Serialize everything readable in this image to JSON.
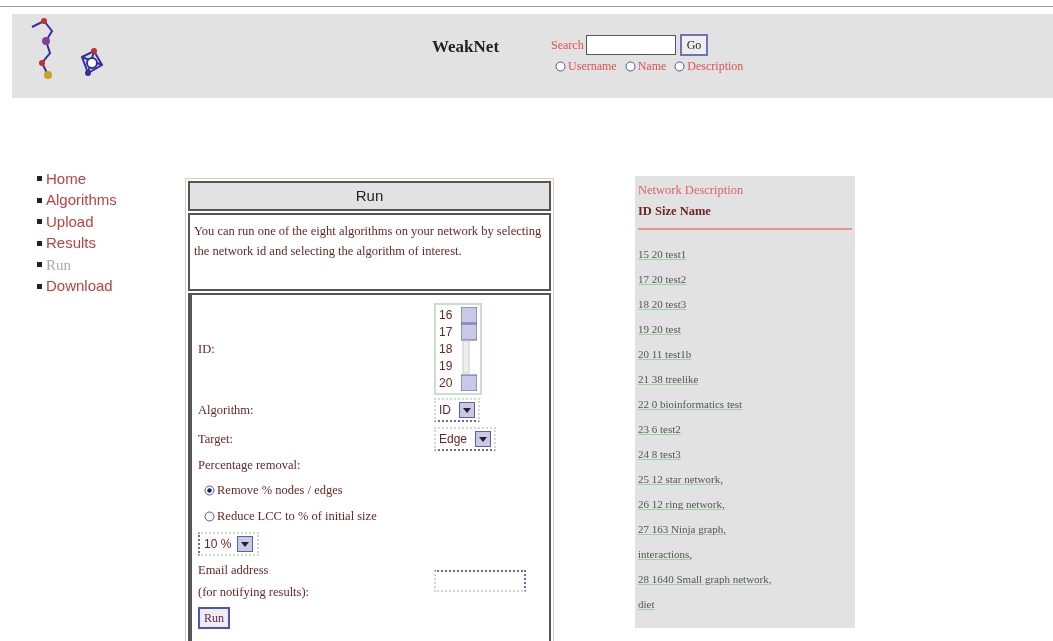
{
  "header": {
    "title": "WeakNet",
    "search": {
      "label": "Search",
      "button": "Go",
      "options": [
        {
          "label": "Username",
          "selected": false
        },
        {
          "label": "Name",
          "selected": false
        },
        {
          "label": "Description",
          "selected": false
        }
      ]
    }
  },
  "nav": [
    {
      "label": "Home",
      "selected": false
    },
    {
      "label": "Algorithms",
      "selected": false
    },
    {
      "label": "Upload",
      "selected": false
    },
    {
      "label": "Results",
      "selected": false
    },
    {
      "label": "Run",
      "selected": true
    },
    {
      "label": "Download",
      "selected": false
    }
  ],
  "run": {
    "title": "Run",
    "intro": "You can run one of the eight algorithms on your network by selecting the network id and selecting the algorithm of interest.",
    "id_label": "ID:",
    "id_options": [
      "16",
      "17",
      "18",
      "19",
      "20"
    ],
    "algorithm_label": "Algorithm:",
    "algorithm_value": "ID",
    "target_label": "Target:",
    "target_value": "Edge",
    "percentage_label": "Percentage removal:",
    "removal_options": [
      {
        "label": "Remove % nodes / edges",
        "selected": true
      },
      {
        "label": "Reduce LCC to % of initial size",
        "selected": false
      }
    ],
    "percentage_value": "10 %",
    "email_label": "Email address",
    "email_hint": "(for notifying results):",
    "submit": "Run"
  },
  "networks": {
    "title": "Network Description",
    "columns": "ID Size Name",
    "items": [
      "15 20 test1",
      "17 20 test2",
      "18 20 test3",
      "19 20 test",
      "20 11 test1b",
      "21 38 treelike",
      "22 0 bioinformatics test",
      "23 6 test2",
      "24 8 test3",
      "25 12 star network,",
      "26 12 ring network,",
      "27 163 Ninja graph,",
      "interactions,",
      "28 1640 Small graph network,",
      "diet"
    ]
  }
}
